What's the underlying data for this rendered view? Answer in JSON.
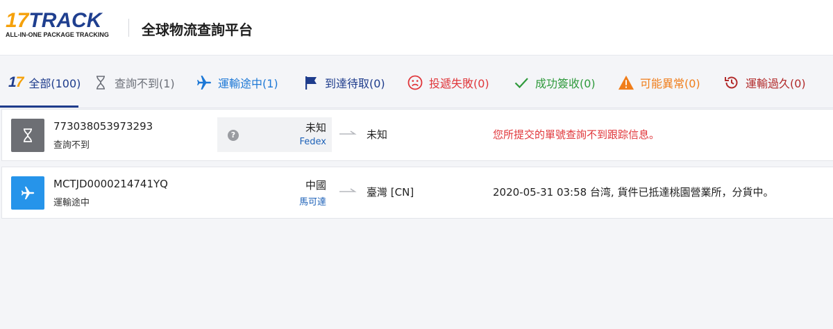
{
  "header": {
    "logo": {
      "number": "17",
      "word": "TRACK",
      "tagline": "ALL-IN-ONE PACKAGE TRACKING"
    },
    "title": "全球物流查詢平台"
  },
  "tabs": [
    {
      "label": "全部(100)",
      "icon": "17-logo-icon",
      "active": true,
      "color": "#1e3c8c"
    },
    {
      "label": "查詢不到(1)",
      "icon": "hourglass-icon",
      "color": "#6b6f78"
    },
    {
      "label": "運輸途中(1)",
      "icon": "airplane-icon",
      "color": "#1d78d6"
    },
    {
      "label": "到達待取(0)",
      "icon": "flag-icon",
      "color": "#1e3c8c"
    },
    {
      "label": "投遞失敗(0)",
      "icon": "sad-face-icon",
      "color": "#e0363a"
    },
    {
      "label": "成功簽收(0)",
      "icon": "check-icon",
      "color": "#2f9a3c"
    },
    {
      "label": "可能異常(0)",
      "icon": "warning-icon",
      "color": "#f07d1a"
    },
    {
      "label": "運輸過久(0)",
      "icon": "history-icon",
      "color": "#b22b2b"
    }
  ],
  "shipments": [
    {
      "tracking_number": "773038053973293",
      "status": "查詢不到",
      "status_icon": "hourglass-icon",
      "origin_country": "未知",
      "carrier": "Fedex",
      "destination": "未知",
      "latest_event": "您所提交的單號查詢不到跟踪信息。"
    },
    {
      "tracking_number": "MCTJD0000214741YQ",
      "status": "運輸途中",
      "status_icon": "airplane-icon",
      "origin_country": "中國",
      "carrier": "馬可達",
      "destination": "臺灣 [CN]",
      "latest_event": "2020-05-31 03:58 台湾, 貨件已抵達桃園營業所，分貨中。"
    }
  ]
}
